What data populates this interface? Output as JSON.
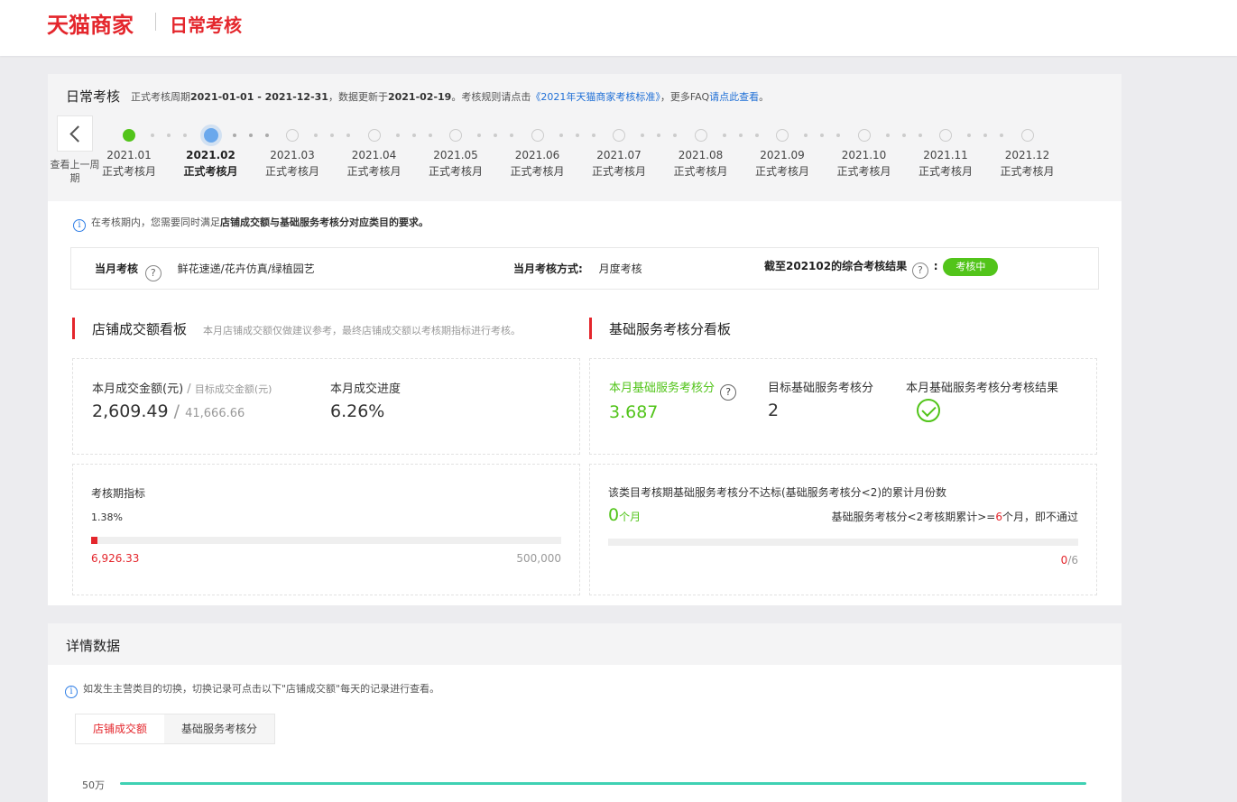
{
  "header": {
    "brand": "天猫商家",
    "page": "日常考核"
  },
  "exam": {
    "title": "日常考核",
    "subtitle": {
      "period_prefix": "正式考核周期",
      "period": "2021-01-01 - 2021-12-31",
      "update_prefix": "，数据更新于",
      "update_date": "2021-02-19",
      "rule_prefix": "。考核规则请点击",
      "rule_link": "《2021年天猫商家考核标准》",
      "faq_prefix": "，更多FAQ",
      "faq_link": "请点此查看",
      "end": "。"
    },
    "back_label": "查看上一周期",
    "months": [
      {
        "month": "2021.01",
        "label": "正式考核月",
        "state": "done"
      },
      {
        "month": "2021.02",
        "label": "正式考核月",
        "state": "current"
      },
      {
        "month": "2021.03",
        "label": "正式考核月",
        "state": "future"
      },
      {
        "month": "2021.04",
        "label": "正式考核月",
        "state": "future"
      },
      {
        "month": "2021.05",
        "label": "正式考核月",
        "state": "future"
      },
      {
        "month": "2021.06",
        "label": "正式考核月",
        "state": "future"
      },
      {
        "month": "2021.07",
        "label": "正式考核月",
        "state": "future"
      },
      {
        "month": "2021.08",
        "label": "正式考核月",
        "state": "future"
      },
      {
        "month": "2021.09",
        "label": "正式考核月",
        "state": "future"
      },
      {
        "month": "2021.10",
        "label": "正式考核月",
        "state": "future"
      },
      {
        "month": "2021.11",
        "label": "正式考核月",
        "state": "future"
      },
      {
        "month": "2021.12",
        "label": "正式考核月",
        "state": "future"
      }
    ],
    "notice": {
      "prefix": "在考核期内，您需要同时满足",
      "bold": "店铺成交额与基础服务考核分对应类目的要求。"
    },
    "summary": {
      "month_label": "当月考核",
      "category": "鲜花速递/花卉仿真/绿植园艺",
      "method_label": "当月考核方式:",
      "method": "月度考核",
      "result_label": "截至202102的综合考核结果",
      "result_colon": ":",
      "result_badge": "考核中"
    }
  },
  "gmv_board": {
    "title": "店铺成交额看板",
    "note": "本月店铺成交额仅做建议参考，最终店铺成交额以考核期指标进行考核。",
    "amount_label": "本月成交金额(元)",
    "slash": "/",
    "target_label": "目标成交金额(元)",
    "amount": "2,609.49",
    "target": "41,666.66",
    "progress_label": "本月成交进度",
    "progress": "6.26%",
    "period_label": "考核期指标",
    "period_pct": "1.38%",
    "period_fraction": 0.0138,
    "period_current": "6,926.33",
    "period_target": "500,000"
  },
  "service_board": {
    "title": "基础服务考核分看板",
    "score_label": "本月基础服务考核分",
    "score": "3.687",
    "target_label": "目标基础服务考核分",
    "target": "2",
    "result_label": "本月基础服务考核分考核结果",
    "fail_title": "该类目考核期基础服务考核分不达标(基础服务考核分<2)的累计月份数",
    "fail_count": "0",
    "fail_unit": "个月",
    "rule_prefix": "基础服务考核分<2考核期累计>=",
    "rule_num": "6",
    "rule_suffix": "个月，即不通过",
    "fail_fraction": 0,
    "fail_current": "0",
    "fail_total": "/6"
  },
  "detail": {
    "title": "详情数据",
    "notice": "如发生主营类目的切换，切换记录可点击以下\"店铺成交额\"每天的记录进行查看。",
    "tabs": [
      "店铺成交额",
      "基础服务考核分"
    ],
    "y_tick": "50万"
  },
  "colors": {
    "brand_red": "#e4262c",
    "green": "#52c41a",
    "link_blue": "#1f6fd6",
    "line_teal": "#3fd1b3",
    "current_dot": "#6aa8ec"
  }
}
